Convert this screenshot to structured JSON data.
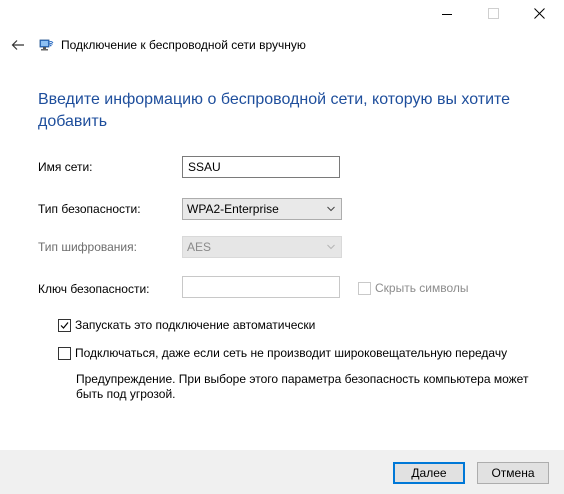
{
  "window": {
    "minimize_label": "—",
    "maximize_label": "□",
    "close_label": "✕"
  },
  "header": {
    "back_icon": "back-arrow-icon",
    "network_icon": "wireless-network-icon",
    "title": "Подключение к беспроводной сети вручную"
  },
  "heading": "Введите информацию о беспроводной сети, которую вы хотите добавить",
  "form": {
    "network_name": {
      "label": "Имя сети:",
      "value": "SSAU"
    },
    "security_type": {
      "label": "Тип безопасности:",
      "value": "WPA2-Enterprise"
    },
    "encryption_type": {
      "label": "Тип шифрования:",
      "value": "AES"
    },
    "security_key": {
      "label": "Ключ безопасности:",
      "value": "",
      "hide_chars_label": "Скрыть символы",
      "hide_chars_checked": false
    }
  },
  "options": {
    "auto_connect": {
      "label": "Запускать это подключение автоматически",
      "checked": true
    },
    "connect_hidden": {
      "label": "Подключаться, даже если сеть не производит широковещательную передачу",
      "checked": false
    },
    "warning": "Предупреждение. При выборе этого параметра безопасность компьютера может быть под угрозой."
  },
  "footer": {
    "next_label": "Далее",
    "cancel_label": "Отмена"
  },
  "colors": {
    "heading": "#1e4e9c",
    "footer_bg": "#f0f0f0",
    "primary_border": "#0078d7"
  }
}
